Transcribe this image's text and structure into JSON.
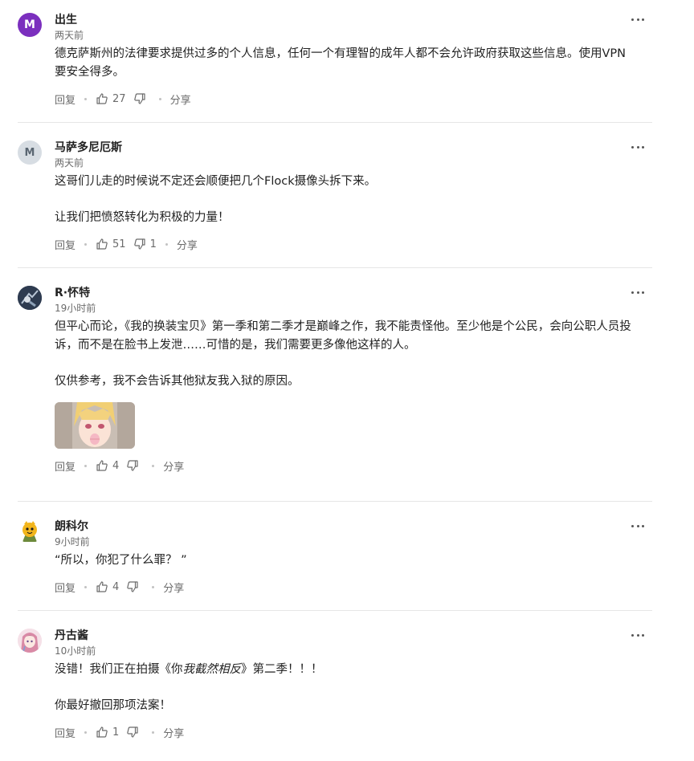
{
  "actions": {
    "reply": "回复",
    "share": "分享"
  },
  "comments": [
    {
      "author": "出生",
      "avatar_letter": "M",
      "time": "两天前",
      "paragraphs": [
        "德克萨斯州的法律要求提供过多的个人信息，任何一个有理智的成年人都不会允许政府获取这些信息。使用VPN要安全得多。"
      ],
      "likes": "27",
      "dislikes": ""
    },
    {
      "author": "马萨多尼厄斯",
      "avatar_letter": "M",
      "time": "两天前",
      "paragraphs": [
        "这哥们儿走的时候说不定还会顺便把几个Flock摄像头拆下来。",
        "让我们把愤怒转化为积极的力量！"
      ],
      "likes": "51",
      "dislikes": "1"
    },
    {
      "author": "R·怀特",
      "time": "19小时前",
      "paragraphs": [
        "但平心而论，《我的换装宝贝》第一季和第二季才是巅峰之作，我不能责怪他。至少他是个公民，会向公职人员投诉，而不是在脸书上发泄……可惜的是，我们需要更多像他这样的人。",
        "仅供参考，我不会告诉其他狱友我入狱的原因。"
      ],
      "likes": "4",
      "dislikes": ""
    },
    {
      "author": "朗科尔",
      "time": "9小时前",
      "paragraphs": [
        "“所以，你犯了什么罪？ ”"
      ],
      "likes": "4",
      "dislikes": ""
    },
    {
      "author": "丹古酱",
      "time": "10小时前",
      "paragraph_1_prefix": "没错！我们正在拍摄《你",
      "paragraph_1_italic": "我截然相反",
      "paragraph_1_suffix": "》第二季！！！",
      "paragraph_2": "你最好撤回那项法案！",
      "likes": "1",
      "dislikes": ""
    }
  ]
}
